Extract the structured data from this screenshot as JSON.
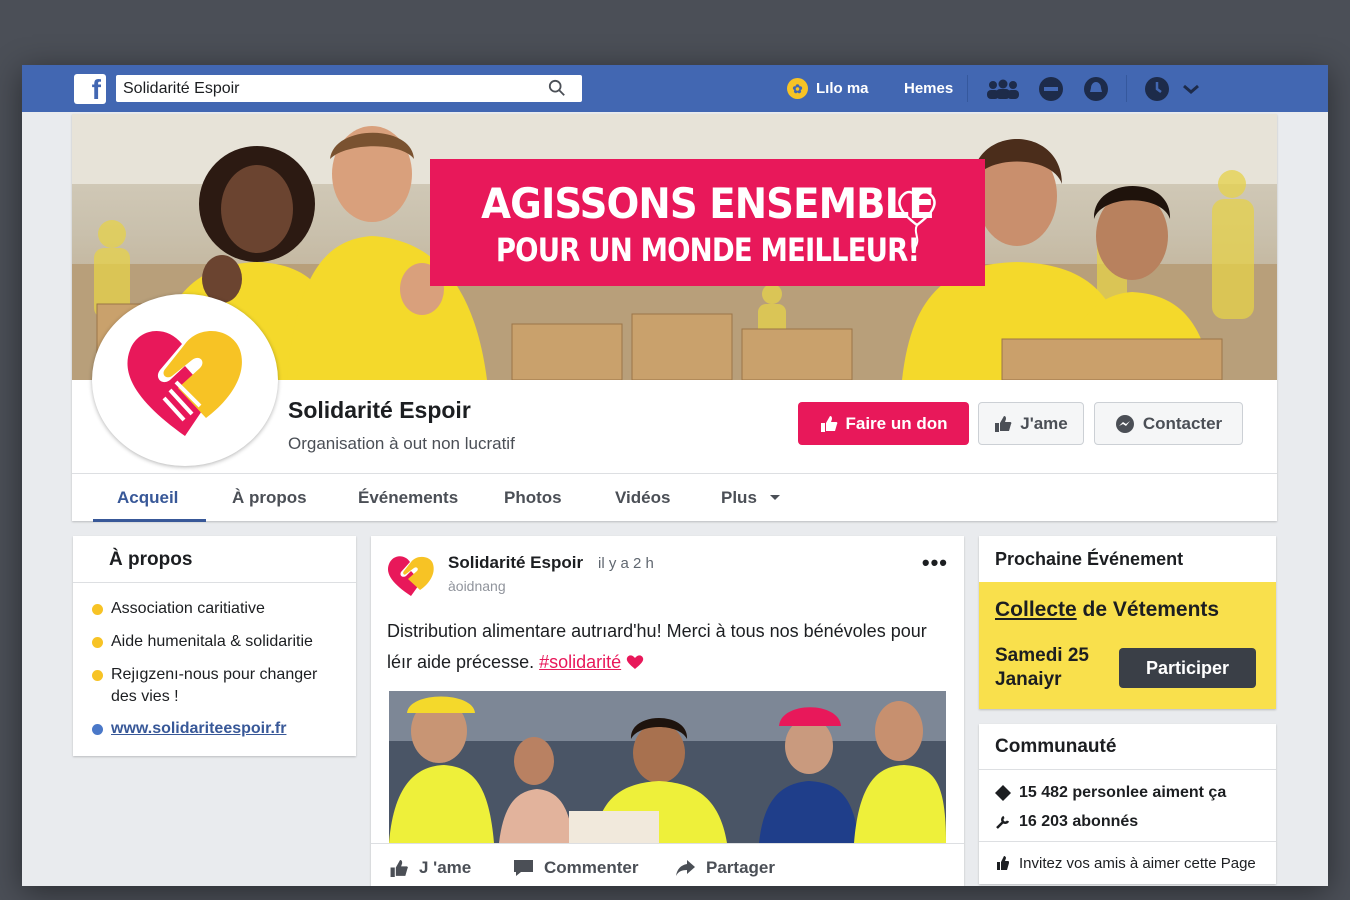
{
  "topbar": {
    "logo": "f",
    "search_value": "Solidarité Espoir",
    "user_label": "Lılo ma",
    "home_label": "Hemes",
    "icons": [
      "friends-icon",
      "messages-icon",
      "notifications-icon",
      "help-icon",
      "chevron-down-icon"
    ]
  },
  "cover": {
    "banner_line1": "AGISSONS ENSEMBLE",
    "banner_line2": "POUR UN MONDE MEILLEUR!"
  },
  "page": {
    "name": "Solidarité Espoir",
    "category": "Organisation à out non lucratif"
  },
  "actions": {
    "donate": "Faire un don",
    "like": "J'ame",
    "contact": "Contacter"
  },
  "tabs": [
    {
      "label": "Acqueil",
      "active": true
    },
    {
      "label": "À propos"
    },
    {
      "label": "Événements"
    },
    {
      "label": "Photos"
    },
    {
      "label": "Vidéos"
    },
    {
      "label": "Plus"
    }
  ],
  "about": {
    "title": "À propos",
    "items": [
      "Association caritiative",
      "Aide humenitala & solidaritie",
      "Rejıgzenı-nous pour changer des vies !"
    ],
    "link": "www.solidariteespoir.fr"
  },
  "post": {
    "author": "Solidarité Espoir",
    "time": "il y a 2 h",
    "subline": "àoidnang",
    "text": "Distribution alimentare autrıard'hu! Merci à tous nos bénévoles pour léır aide précesse.",
    "hashtag": "#solidarité",
    "actions": {
      "like": "J 'ame",
      "comment": "Commenter",
      "share": "Partager"
    }
  },
  "event": {
    "header": "Prochaine Événement",
    "title_underlined": "Collecte",
    "title_rest": "de Vétements",
    "date": "Samedi 25 Janaiyr",
    "button": "Participer"
  },
  "community": {
    "header": "Communauté",
    "likes": "15 482 personlee aiment ça",
    "followers": "16 203 abonnés",
    "invite": "Invitez vos amis à aimer cette Page"
  },
  "colors": {
    "facebook_blue": "#4267b2",
    "brand_pink": "#e8185a",
    "brand_yellow": "#f7c325",
    "event_yellow": "#f9e04c"
  }
}
